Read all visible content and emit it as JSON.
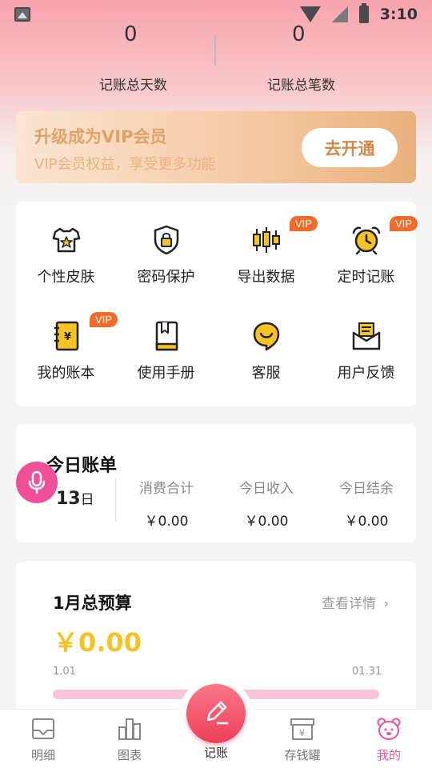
{
  "status_bar": {
    "time": "3:10"
  },
  "stats": {
    "total_days_value": "0",
    "total_days_label": "记账总天数",
    "total_count_value": "0",
    "total_count_label": "记账总笔数"
  },
  "vip_banner": {
    "title": "升级成为VIP会员",
    "subtitle": "VIP会员权益，享受更多功能",
    "button": "去开通"
  },
  "features": [
    {
      "label": "个性皮肤",
      "icon": "shirt-star-icon",
      "vip": false
    },
    {
      "label": "密码保护",
      "icon": "shield-lock-icon",
      "vip": false
    },
    {
      "label": "导出数据",
      "icon": "candlestick-chart-icon",
      "vip": true
    },
    {
      "label": "定时记账",
      "icon": "alarm-clock-icon",
      "vip": true
    },
    {
      "label": "我的账本",
      "icon": "ledger-book-icon",
      "vip": true
    },
    {
      "label": "使用手册",
      "icon": "manual-book-icon",
      "vip": false
    },
    {
      "label": "客服",
      "icon": "smile-chat-icon",
      "vip": false
    },
    {
      "label": "用户反馈",
      "icon": "envelope-icon",
      "vip": false
    }
  ],
  "vip_badge_text": "VIP",
  "today_bill": {
    "title": "今日账单",
    "day": "13",
    "day_unit": "日",
    "expense_label": "消费合计",
    "expense_value": "￥0.00",
    "income_label": "今日收入",
    "income_value": "￥0.00",
    "balance_label": "今日结余",
    "balance_value": "￥0.00"
  },
  "budget": {
    "title": "1月总预算",
    "link": "查看详情",
    "amount": "￥0.00",
    "start": "1.01",
    "end": "01.31"
  },
  "nav": {
    "items": [
      {
        "label": "明细",
        "icon": "detail-list-icon"
      },
      {
        "label": "图表",
        "icon": "bar-chart-icon"
      },
      {
        "label": "记账",
        "icon": "pen-edit-icon"
      },
      {
        "label": "存钱罐",
        "icon": "saving-box-icon"
      },
      {
        "label": "我的",
        "icon": "bear-profile-icon"
      }
    ],
    "active": "我的"
  },
  "colors": {
    "accent": "#f0509a",
    "vip_gold": "#e0a26a",
    "budget_yellow": "#f6c324",
    "vip_badge": "#f26b2b",
    "icon_yellow": "#f6c324"
  }
}
